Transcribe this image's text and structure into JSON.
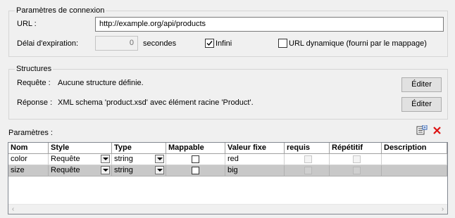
{
  "connection": {
    "title": "Paramètres de connexion",
    "url_label": "URL :",
    "url_value": "http://example.org/api/products",
    "timeout_label": "Délai d'expiration:",
    "timeout_value": "0",
    "timeout_unit": "secondes",
    "infinite_label": "Infini",
    "infinite_checked": true,
    "dynamic_url_label": "URL dynamique (fourni par le mappage)",
    "dynamic_url_checked": false
  },
  "structures": {
    "title": "Structures",
    "request_label": "Requête :",
    "request_value": "Aucune structure définie.",
    "request_button": "Éditer",
    "response_label": "Réponse :",
    "response_value": "XML schema 'product.xsd' avec élément racine 'Product'.",
    "response_button": "Éditer"
  },
  "parameters": {
    "title": "Paramètres :",
    "toolbar_icons": [
      "add-parameter-icon",
      "delete-icon"
    ],
    "columns": [
      "Nom",
      "Style",
      "Type",
      "Mappable",
      "Valeur fixe",
      "requis",
      "Répétitif",
      "Description"
    ],
    "rows": [
      {
        "name": "color",
        "style": "Requête",
        "type": "string",
        "mappable": false,
        "fixed": "red",
        "required": false,
        "repeating": false,
        "description": "",
        "selected": false
      },
      {
        "name": "size",
        "style": "Requête",
        "type": "string",
        "mappable": false,
        "fixed": "big",
        "required": false,
        "repeating": false,
        "description": "",
        "selected": true
      }
    ]
  }
}
